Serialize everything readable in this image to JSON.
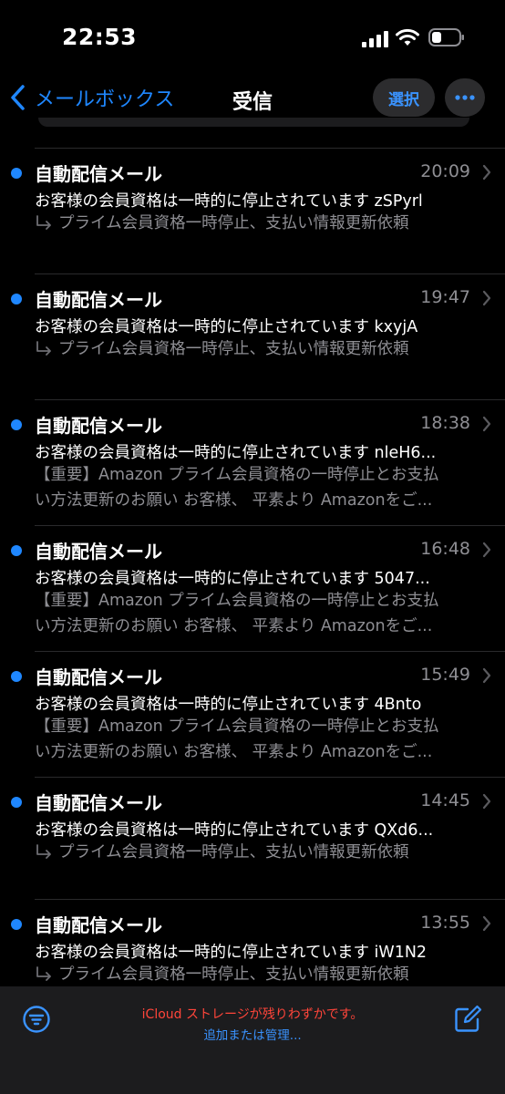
{
  "status_bar": {
    "time": "22:53",
    "icons": [
      "cellular-signal-icon",
      "wifi-icon",
      "battery-icon"
    ]
  },
  "nav": {
    "back_label": "メールボックス",
    "title": "受信",
    "select_label": "選択",
    "accent_color": "#1f87ff"
  },
  "mails": [
    {
      "sender": "自動配信メール",
      "time": "20:09",
      "subject": "お客様の会員資格は一時的に停止されています zSPyrl",
      "preview": "プライム会員資格一時停止、支払い情報更新依頼",
      "preview_line2": "",
      "unread": true,
      "replied": true
    },
    {
      "sender": "自動配信メール",
      "time": "19:47",
      "subject": "お客様の会員資格は一時的に停止されています kxyjA",
      "preview": "プライム会員資格一時停止、支払い情報更新依頼",
      "preview_line2": "",
      "unread": true,
      "replied": true
    },
    {
      "sender": "自動配信メール",
      "time": "18:38",
      "subject": "お客様の会員資格は一時的に停止されています nleH6...",
      "preview": "【重要】Amazon プライム会員資格の一時停止とお支払",
      "preview_line2": "い方法更新のお願い お客様、 平素より Amazonをご...",
      "unread": true,
      "replied": false
    },
    {
      "sender": "自動配信メール",
      "time": "16:48",
      "subject": "お客様の会員資格は一時的に停止されています 5047...",
      "preview": "【重要】Amazon プライム会員資格の一時停止とお支払",
      "preview_line2": "い方法更新のお願い お客様、 平素より Amazonをご...",
      "unread": true,
      "replied": false
    },
    {
      "sender": "自動配信メール",
      "time": "15:49",
      "subject": "お客様の会員資格は一時的に停止されています 4Bnto",
      "preview": "【重要】Amazon プライム会員資格の一時停止とお支払",
      "preview_line2": "い方法更新のお願い お客様、 平素より Amazonをご...",
      "unread": true,
      "replied": false
    },
    {
      "sender": "自動配信メール",
      "time": "14:45",
      "subject": "お客様の会員資格は一時的に停止されています QXd6...",
      "preview": "プライム会員資格一時停止、支払い情報更新依頼",
      "preview_line2": "",
      "unread": true,
      "replied": true
    },
    {
      "sender": "自動配信メール",
      "time": "13:55",
      "subject": "お客様の会員資格は一時的に停止されています iW1N2",
      "preview": "プライム会員資格一時停止、支払い情報更新依頼",
      "preview_line2": "",
      "unread": true,
      "replied": true
    }
  ],
  "toolbar": {
    "storage_warning": "iCloud ストレージが残りわずかです。",
    "manage_link": "追加または管理...",
    "warning_color": "#ff453a"
  }
}
